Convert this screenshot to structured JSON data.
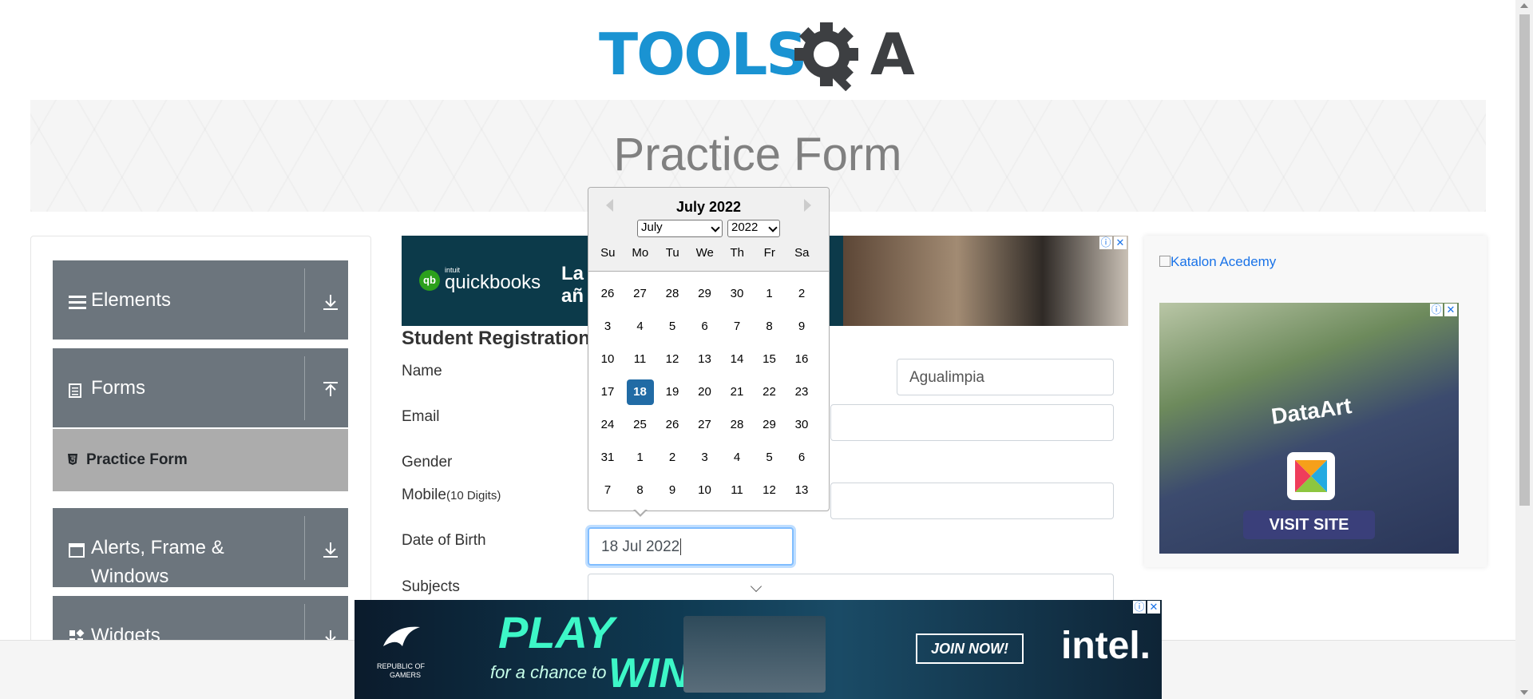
{
  "header": {
    "logo_alt": "TOOLSQA",
    "logo_text": "TOOLS",
    "logo_q": "Q",
    "logo_a": "A"
  },
  "banner": {
    "title": "Practice Form"
  },
  "sidebar": {
    "groups": [
      {
        "label": "Elements",
        "icon": "hamburger-icon",
        "arrow": "download-arrow-icon"
      },
      {
        "label": "Forms",
        "icon": "document-icon",
        "arrow": "upload-arrow-icon"
      },
      {
        "label": "Alerts, Frame &",
        "label2": "Windows",
        "icon": "window-icon",
        "arrow": "download-arrow-icon"
      },
      {
        "label": "Widgets",
        "icon": "widgets-icon",
        "arrow": "download-arrow-icon"
      }
    ],
    "active_item": {
      "label": "Practice Form",
      "icon": "html5-icon"
    }
  },
  "form": {
    "heading": "Student Registration",
    "name_label": "Name",
    "last_name_value": "Agualimpia",
    "email_label": "Email",
    "gender_label": "Gender",
    "mobile_label": "Mobile",
    "mobile_hint": "(10 Digits)",
    "dob_label": "Date of Birth",
    "dob_value": "18 Jul 2022",
    "subjects_label": "Subjects"
  },
  "calendar": {
    "title": "July 2022",
    "month_select": "July",
    "year_select": "2022",
    "weekdays": [
      "Su",
      "Mo",
      "Tu",
      "We",
      "Th",
      "Fr",
      "Sa"
    ],
    "weeks": [
      [
        "26",
        "27",
        "28",
        "29",
        "30",
        "1",
        "2"
      ],
      [
        "3",
        "4",
        "5",
        "6",
        "7",
        "8",
        "9"
      ],
      [
        "10",
        "11",
        "12",
        "13",
        "14",
        "15",
        "16"
      ],
      [
        "17",
        "18",
        "19",
        "20",
        "21",
        "22",
        "23"
      ],
      [
        "24",
        "25",
        "26",
        "27",
        "28",
        "29",
        "30"
      ],
      [
        "31",
        "1",
        "2",
        "3",
        "4",
        "5",
        "6"
      ],
      [
        "7",
        "8",
        "9",
        "10",
        "11",
        "12",
        "13"
      ]
    ],
    "selected_day": "18"
  },
  "ads": {
    "quickbooks": {
      "brand_small": "intuit",
      "brand": "quickbooks",
      "text1": "La",
      "text2": "añ"
    },
    "katalon_alt": "Katalon Acedemy",
    "dataart": {
      "brand": "DataArt",
      "cta": "VISIT SITE"
    },
    "bottom": {
      "rog_line1": "REPUBLIC OF",
      "rog_line2": "GAMERS",
      "play": "PLAY",
      "chance": "for a chance to",
      "win": "WIN",
      "join": "JOIN NOW!",
      "intel": "intel."
    },
    "info": "ⓘ",
    "close": "✕"
  },
  "colors": {
    "sidebar_group": "#6c757d",
    "selected_day": "#216ba5",
    "logo_blue": "#1a93d2"
  }
}
